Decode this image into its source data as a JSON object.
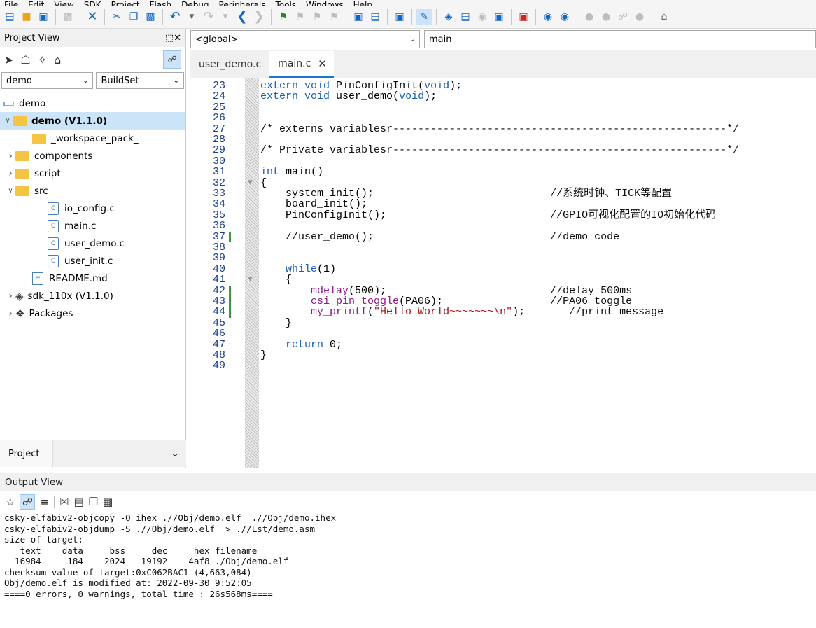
{
  "menubar": {
    "items": [
      "File",
      "Edit",
      "View",
      "SDK",
      "Project",
      "Flash",
      "Debug",
      "Peripherals",
      "Tools",
      "Windows",
      "Help"
    ]
  },
  "toolbar": {
    "icons": [
      "new-file-icon",
      "open-folder-icon",
      "save-all-icon",
      "save-icon",
      "close-icon",
      "cut-icon",
      "copy-icon",
      "paste-icon",
      "undo-icon",
      "redo-icon",
      "back-icon",
      "forward-icon",
      "bookmark-icon",
      "bookmark-prev-icon",
      "bookmark-next-icon",
      "bookmark-clear-icon",
      "search-icon",
      "search-file-icon",
      "search-replace-icon",
      "build-icon",
      "package-icon",
      "download-icon",
      "stop-icon",
      "flash-erase-icon",
      "debug-start-icon",
      "zoom-in-icon",
      "zoom-out-icon",
      "step-icon",
      "link-icon",
      "watch-icon",
      "home-icon"
    ]
  },
  "project_view": {
    "title": "Project View",
    "pin_label": "⬚✕",
    "project_select": "demo",
    "buildset_select": "BuildSet",
    "tree": [
      {
        "label": "demo",
        "level": 0,
        "kind": "workspace",
        "arrow": ""
      },
      {
        "label": "demo (V1.1.0)",
        "level": 0,
        "kind": "folder-open",
        "arrow": "v",
        "bold": true,
        "selected": true
      },
      {
        "label": "_workspace_pack_",
        "level": 2,
        "kind": "folder",
        "arrow": ""
      },
      {
        "label": "components",
        "level": 1,
        "kind": "folder",
        "arrow": ">"
      },
      {
        "label": "script",
        "level": 1,
        "kind": "folder",
        "arrow": ">"
      },
      {
        "label": "src",
        "level": 1,
        "kind": "folder",
        "arrow": "v"
      },
      {
        "label": "io_config.c",
        "level": 3,
        "kind": "cfile",
        "arrow": ""
      },
      {
        "label": "main.c",
        "level": 3,
        "kind": "cfile",
        "arrow": ""
      },
      {
        "label": "user_demo.c",
        "level": 3,
        "kind": "cfile",
        "arrow": ""
      },
      {
        "label": "user_init.c",
        "level": 3,
        "kind": "cfile",
        "arrow": ""
      },
      {
        "label": "README.md",
        "level": 2,
        "kind": "md",
        "arrow": ""
      },
      {
        "label": "sdk_110x (V1.1.0)",
        "level": 1,
        "kind": "sdk",
        "arrow": ">"
      },
      {
        "label": "Packages",
        "level": 1,
        "kind": "pkg",
        "arrow": ">"
      }
    ],
    "bottom_tab": "Project"
  },
  "editor": {
    "scope": "<global>",
    "function": "main",
    "tabs": [
      {
        "label": "user_demo.c",
        "active": false
      },
      {
        "label": "main.c",
        "active": true
      }
    ],
    "lines": [
      {
        "n": "23",
        "t": "extern void PinConfigInit(void);"
      },
      {
        "n": "24",
        "t": "extern void user_demo(void);"
      },
      {
        "n": "25",
        "t": ""
      },
      {
        "n": "26",
        "t": ""
      },
      {
        "n": "27",
        "t": "/* externs variablesr-----------------------------------------------------*/"
      },
      {
        "n": "28",
        "t": ""
      },
      {
        "n": "29",
        "t": "/* Private variablesr-----------------------------------------------------*/"
      },
      {
        "n": "30",
        "t": ""
      },
      {
        "n": "31",
        "t": "int main()"
      },
      {
        "n": "32",
        "t": "{"
      },
      {
        "n": "33",
        "t": "    system_init();                            //系统时钟、TICK等配置"
      },
      {
        "n": "34",
        "t": "    board_init();"
      },
      {
        "n": "35",
        "t": "    PinConfigInit();                          //GPIO可视化配置的IO初始化代码"
      },
      {
        "n": "36",
        "t": ""
      },
      {
        "n": "37",
        "t": "    //user_demo();                            //demo code"
      },
      {
        "n": "38",
        "t": ""
      },
      {
        "n": "39",
        "t": ""
      },
      {
        "n": "40",
        "t": "    while(1)"
      },
      {
        "n": "41",
        "t": "    {"
      },
      {
        "n": "42",
        "t": "        mdelay(500);                          //delay 500ms"
      },
      {
        "n": "43",
        "t": "        csi_pin_toggle(PA06);                 //PA06 toggle"
      },
      {
        "n": "44",
        "t": "        my_printf(\"Hello World~~~~~~~\\n\");       //print message"
      },
      {
        "n": "45",
        "t": "    }"
      },
      {
        "n": "46",
        "t": ""
      },
      {
        "n": "47",
        "t": "    return 0;"
      },
      {
        "n": "48",
        "t": "}"
      },
      {
        "n": "49",
        "t": ""
      }
    ],
    "changed_lines": [
      "37",
      "42",
      "43",
      "44"
    ]
  },
  "output_view": {
    "title": "Output View",
    "lines": [
      "csky-elfabiv2-objcopy -O ihex .//Obj/demo.elf  .//Obj/demo.ihex",
      "csky-elfabiv2-objdump -S .//Obj/demo.elf  > .//Lst/demo.asm",
      "size of target:",
      "   text    data     bss     dec     hex filename",
      "  16984     184    2024   19192    4af8 ./Obj/demo.elf",
      "checksum value of target:0xC062BAC1 (4,663,084)",
      "Obj/demo.elf is modified at: 2022-09-30 9:52:05",
      "====0 errors, 0 warnings, total time : 26s568ms===="
    ]
  },
  "colors": {
    "accent": "#1976d2",
    "folder": "#f6c445",
    "change_bar": "#3c9a3c",
    "keyword": "#1a5fb4"
  }
}
